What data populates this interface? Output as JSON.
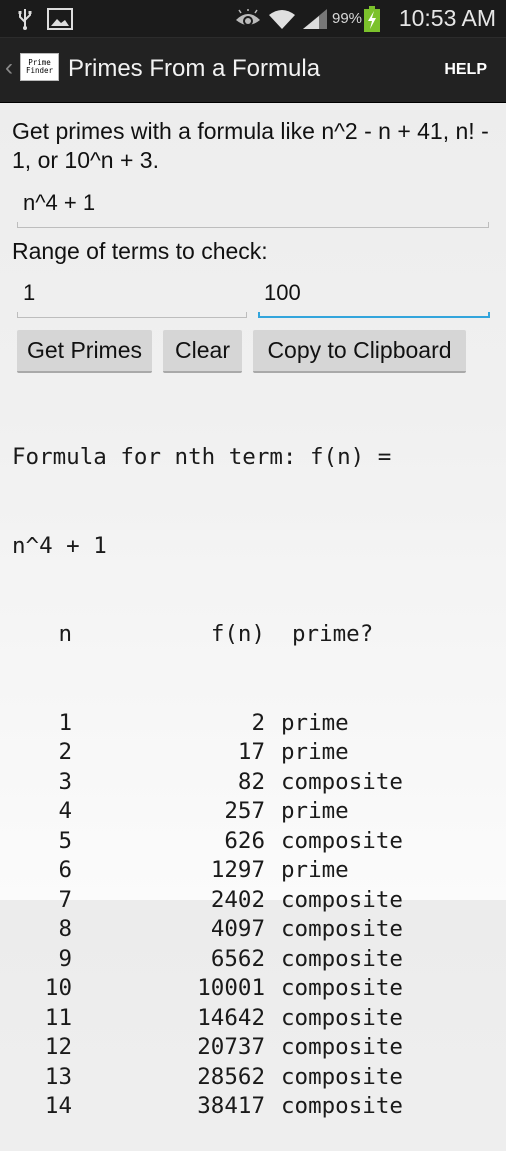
{
  "status_bar": {
    "left_icons": [
      "usb-icon",
      "image-icon"
    ],
    "right_icons": [
      "eye-icon",
      "wifi-icon",
      "signal-icon",
      "battery-charging-icon"
    ],
    "battery_percent": "99%",
    "time": "10:53 AM"
  },
  "action_bar": {
    "logo_line1": "Prime",
    "logo_line2": "Finder",
    "title": "Primes From a Formula",
    "help_label": "HELP"
  },
  "form": {
    "intro": "Get primes with a formula like n^2 - n + 41, n! - 1, or 10^n + 3.",
    "formula_value": "n^4 + 1",
    "range_label": "Range of terms to check:",
    "range_start": "1",
    "range_end": "100",
    "buttons": {
      "get_primes": "Get Primes",
      "clear": "Clear",
      "copy": "Copy to Clipboard"
    }
  },
  "output": {
    "formula_line1": "Formula for nth term: f(n) =",
    "formula_line2": "n^4 + 1",
    "headers": {
      "n": "n",
      "f": "f(n)",
      "prime": "prime?"
    },
    "rows": [
      {
        "n": "1",
        "f": "2",
        "p": "prime"
      },
      {
        "n": "2",
        "f": "17",
        "p": "prime"
      },
      {
        "n": "3",
        "f": "82",
        "p": "composite"
      },
      {
        "n": "4",
        "f": "257",
        "p": "prime"
      },
      {
        "n": "5",
        "f": "626",
        "p": "composite"
      },
      {
        "n": "6",
        "f": "1297",
        "p": "prime"
      },
      {
        "n": "7",
        "f": "2402",
        "p": "composite"
      },
      {
        "n": "8",
        "f": "4097",
        "p": "composite"
      },
      {
        "n": "9",
        "f": "6562",
        "p": "composite"
      },
      {
        "n": "10",
        "f": "10001",
        "p": "composite"
      },
      {
        "n": "11",
        "f": "14642",
        "p": "composite"
      },
      {
        "n": "12",
        "f": "20737",
        "p": "composite"
      },
      {
        "n": "13",
        "f": "28562",
        "p": "composite"
      },
      {
        "n": "14",
        "f": "38417",
        "p": "composite"
      }
    ]
  },
  "colors": {
    "accent": "#33a5dc",
    "action_bar": "#222222",
    "status_bar": "#1b1b1b",
    "battery": "#7cc22c"
  }
}
